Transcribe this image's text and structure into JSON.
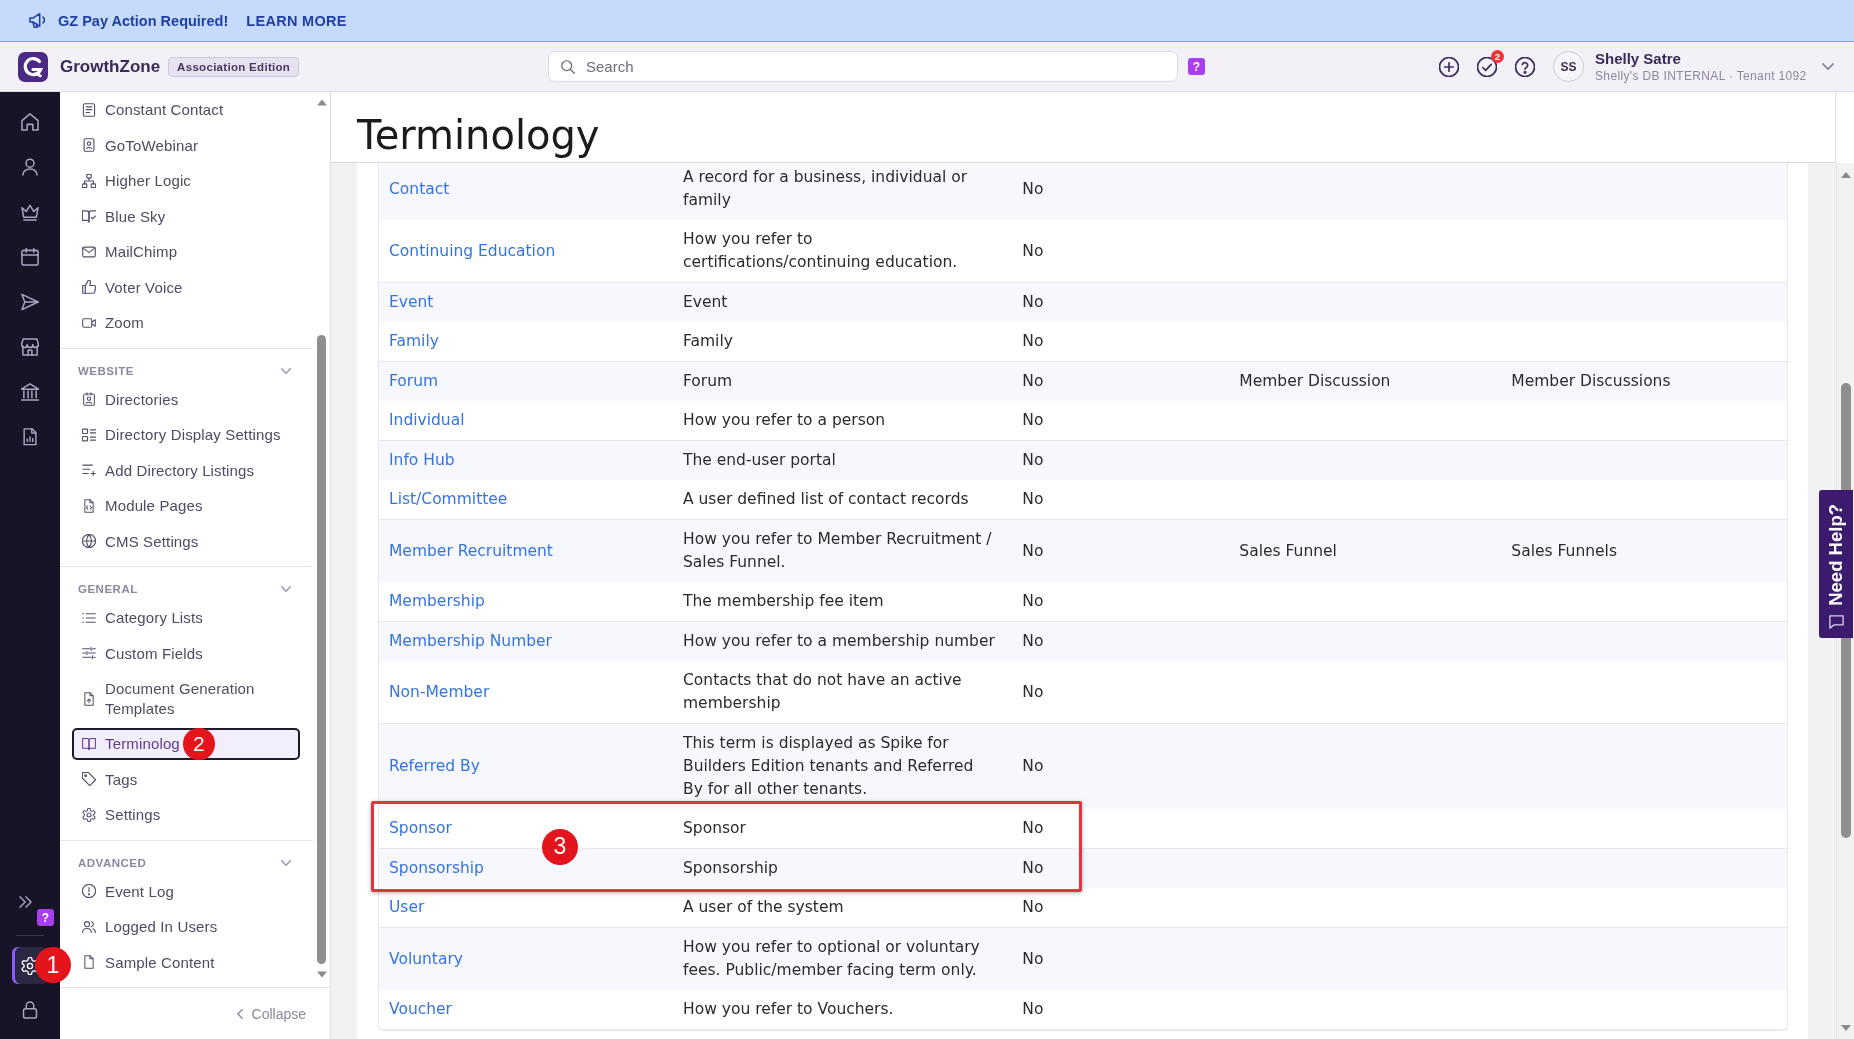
{
  "banner": {
    "message": "GZ Pay Action Required!",
    "link": "LEARN MORE"
  },
  "header": {
    "brand": "GrowthZone",
    "edition": "Association Edition",
    "search": {
      "placeholder": "Search"
    },
    "help_badge": "?",
    "notifications": {
      "count": "2"
    },
    "user": {
      "initials": "SS",
      "name": "Shelly Satre",
      "subtitle": "Shelly's DB INTERNAL · Tenant 1092"
    }
  },
  "rail": {
    "items": [
      {
        "selected": false
      },
      {
        "selected": false
      },
      {
        "selected": false
      },
      {
        "selected": false
      },
      {
        "selected": false
      },
      {
        "selected": false
      },
      {
        "selected": false
      },
      {
        "selected": false
      }
    ],
    "help_badge": "?",
    "bottom_items": [
      {
        "selected": true,
        "callout": "1"
      },
      {
        "selected": false
      }
    ]
  },
  "sidebar": {
    "sections": [
      {
        "items": [
          {
            "label": "Constant Contact",
            "selected": false
          },
          {
            "label": "GoToWebinar",
            "selected": false
          },
          {
            "label": "Higher Logic",
            "selected": false
          },
          {
            "label": "Blue Sky",
            "selected": false
          },
          {
            "label": "MailChimp",
            "selected": false
          },
          {
            "label": "Voter Voice",
            "selected": false
          },
          {
            "label": "Zoom",
            "selected": false
          }
        ]
      },
      {
        "title": "WEBSITE",
        "expanded": true,
        "items": [
          {
            "label": "Directories",
            "selected": false
          },
          {
            "label": "Directory Display Settings",
            "selected": false
          },
          {
            "label": "Add Directory Listings",
            "selected": false
          },
          {
            "label": "Module Pages",
            "selected": false
          },
          {
            "label": "CMS Settings",
            "selected": false
          }
        ]
      },
      {
        "title": "GENERAL",
        "expanded": true,
        "items": [
          {
            "label": "Category Lists",
            "selected": false
          },
          {
            "label": "Custom Fields",
            "selected": false
          },
          {
            "label": "Document Generation Templates",
            "selected": false
          },
          {
            "label": "Terminolog",
            "selected": true,
            "callout": "2"
          },
          {
            "label": "Tags",
            "selected": false
          },
          {
            "label": "Settings",
            "selected": false
          }
        ]
      },
      {
        "title": "ADVANCED",
        "expanded": true,
        "items": [
          {
            "label": "Event Log",
            "selected": false
          },
          {
            "label": "Logged In Users",
            "selected": false
          },
          {
            "label": "Sample Content",
            "selected": false
          }
        ]
      }
    ],
    "collapse": "Collapse"
  },
  "page": {
    "title": "Terminology"
  },
  "table": {
    "rows": [
      {
        "column_1": "Contact",
        "column_2": "A record for a business, individual or family",
        "column_3": "No",
        "highlighted": false
      },
      {
        "column_1": "Continuing Education",
        "column_2": "How you refer to certifications/continuing education.",
        "column_3": "No",
        "highlighted": false
      },
      {
        "column_1": "Event",
        "column_2": "Event",
        "column_3": "No",
        "highlighted": false
      },
      {
        "column_1": "Family",
        "column_2": "Family",
        "column_3": "No",
        "highlighted": false
      },
      {
        "column_1": "Forum",
        "column_2": "Forum",
        "column_3": "No",
        "column_4": "Member Discussion",
        "column_5": "Member Discussions",
        "highlighted": false
      },
      {
        "column_1": "Individual",
        "column_2": "How you refer to a person",
        "column_3": "No",
        "highlighted": false
      },
      {
        "column_1": "Info Hub",
        "column_2": "The end-user portal",
        "column_3": "No",
        "highlighted": false
      },
      {
        "column_1": "List/Committee",
        "column_2": "A user defined list of contact records",
        "column_3": "No",
        "highlighted": false
      },
      {
        "column_1": "Member Recruitment",
        "column_2": "How you refer to Member Recruitment / Sales Funnel.",
        "column_3": "No",
        "column_4": "Sales Funnel",
        "column_5": "Sales Funnels",
        "highlighted": false
      },
      {
        "column_1": "Membership",
        "column_2": "The membership fee item",
        "column_3": "No",
        "highlighted": false
      },
      {
        "column_1": "Membership Number",
        "column_2": "How you refer to a membership number",
        "column_3": "No",
        "highlighted": false
      },
      {
        "column_1": "Non-Member",
        "column_2": "Contacts that do not have an active membership",
        "column_3": "No",
        "highlighted": false
      },
      {
        "column_1": "Referred By",
        "column_2": "This term is displayed as Spike for Builders Edition tenants and Referred By for all other tenants.",
        "column_3": "No",
        "highlighted": false
      },
      {
        "column_1": "Sponsor",
        "column_2": "Sponsor",
        "column_3": "No",
        "highlighted": true
      },
      {
        "column_1": "Sponsorship",
        "column_2": "Sponsorship",
        "column_3": "No",
        "highlighted": true
      },
      {
        "column_1": "User",
        "column_2": "A user of the system",
        "column_3": "No",
        "highlighted": false
      },
      {
        "column_1": "Voluntary",
        "column_2": "How you refer to optional or voluntary fees. Public/member facing term only.",
        "column_3": "No",
        "highlighted": false
      },
      {
        "column_1": "Voucher",
        "column_2": "How you refer to Vouchers.",
        "column_3": "No",
        "highlighted": false
      }
    ],
    "highlight": {
      "callout": "3"
    }
  },
  "help_tab": {
    "label": "Need Help?"
  }
}
